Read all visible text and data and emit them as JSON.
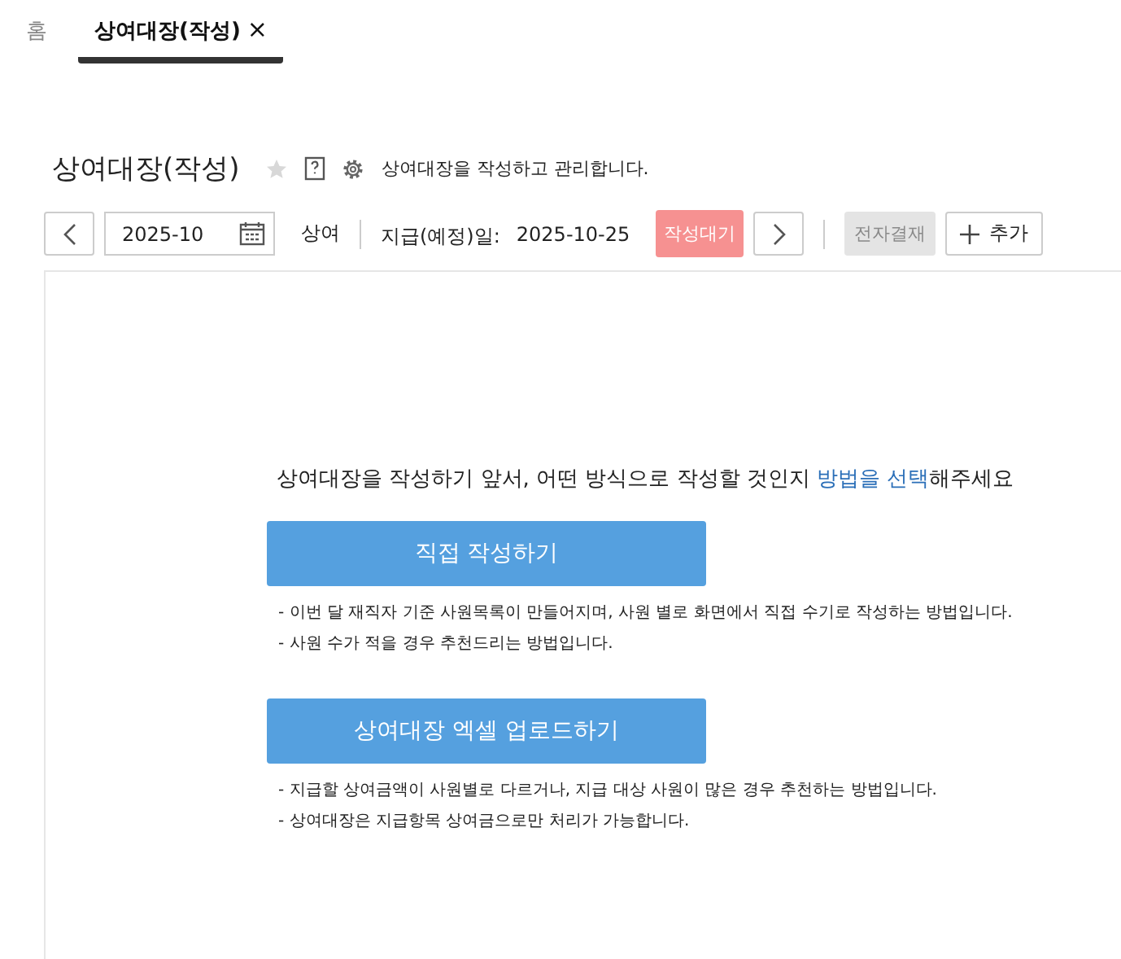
{
  "tabs": [
    {
      "label": "홈",
      "selected": false
    },
    {
      "label": "상여대장(작성)",
      "selected": true,
      "close": "×"
    }
  ],
  "page": {
    "title": "상여대장(작성)",
    "favorite": false,
    "description": "상여대장을 작성하고 관리합니다."
  },
  "toolbar": {
    "month": "2025-10",
    "type": "상여",
    "pay_date_label": "지급(예정)일:",
    "pay_date": "2025-10-25",
    "status": "작성대기",
    "approval": {
      "label": "전자결재",
      "disabled": true
    },
    "add": "추가"
  },
  "prompt": {
    "before": "상여대장을 작성하기 앞서, 어떤 방식으로 작성할 것인지 ",
    "highlight": "방법을 선택",
    "after": "해주세요"
  },
  "options": [
    {
      "label": "직접 작성하기",
      "notes": [
        "- 이번 달 재직자 기준 사원목록이 만들어지며, 사원 별로 화면에서 직접 수기로 작성하는 방법입니다.",
        "- 사원 수가 적을 경우 추천드리는 방법입니다."
      ]
    },
    {
      "label": "상여대장 엑셀 업로드하기",
      "notes": [
        "- 지급할 상여금액이 사원별로 다르거나, 지급 대상 사원이 많은 경우 추천하는 방법입니다.",
        "- 상여대장은 지급항목 상여금으로만 처리가 가능합니다."
      ]
    }
  ]
}
